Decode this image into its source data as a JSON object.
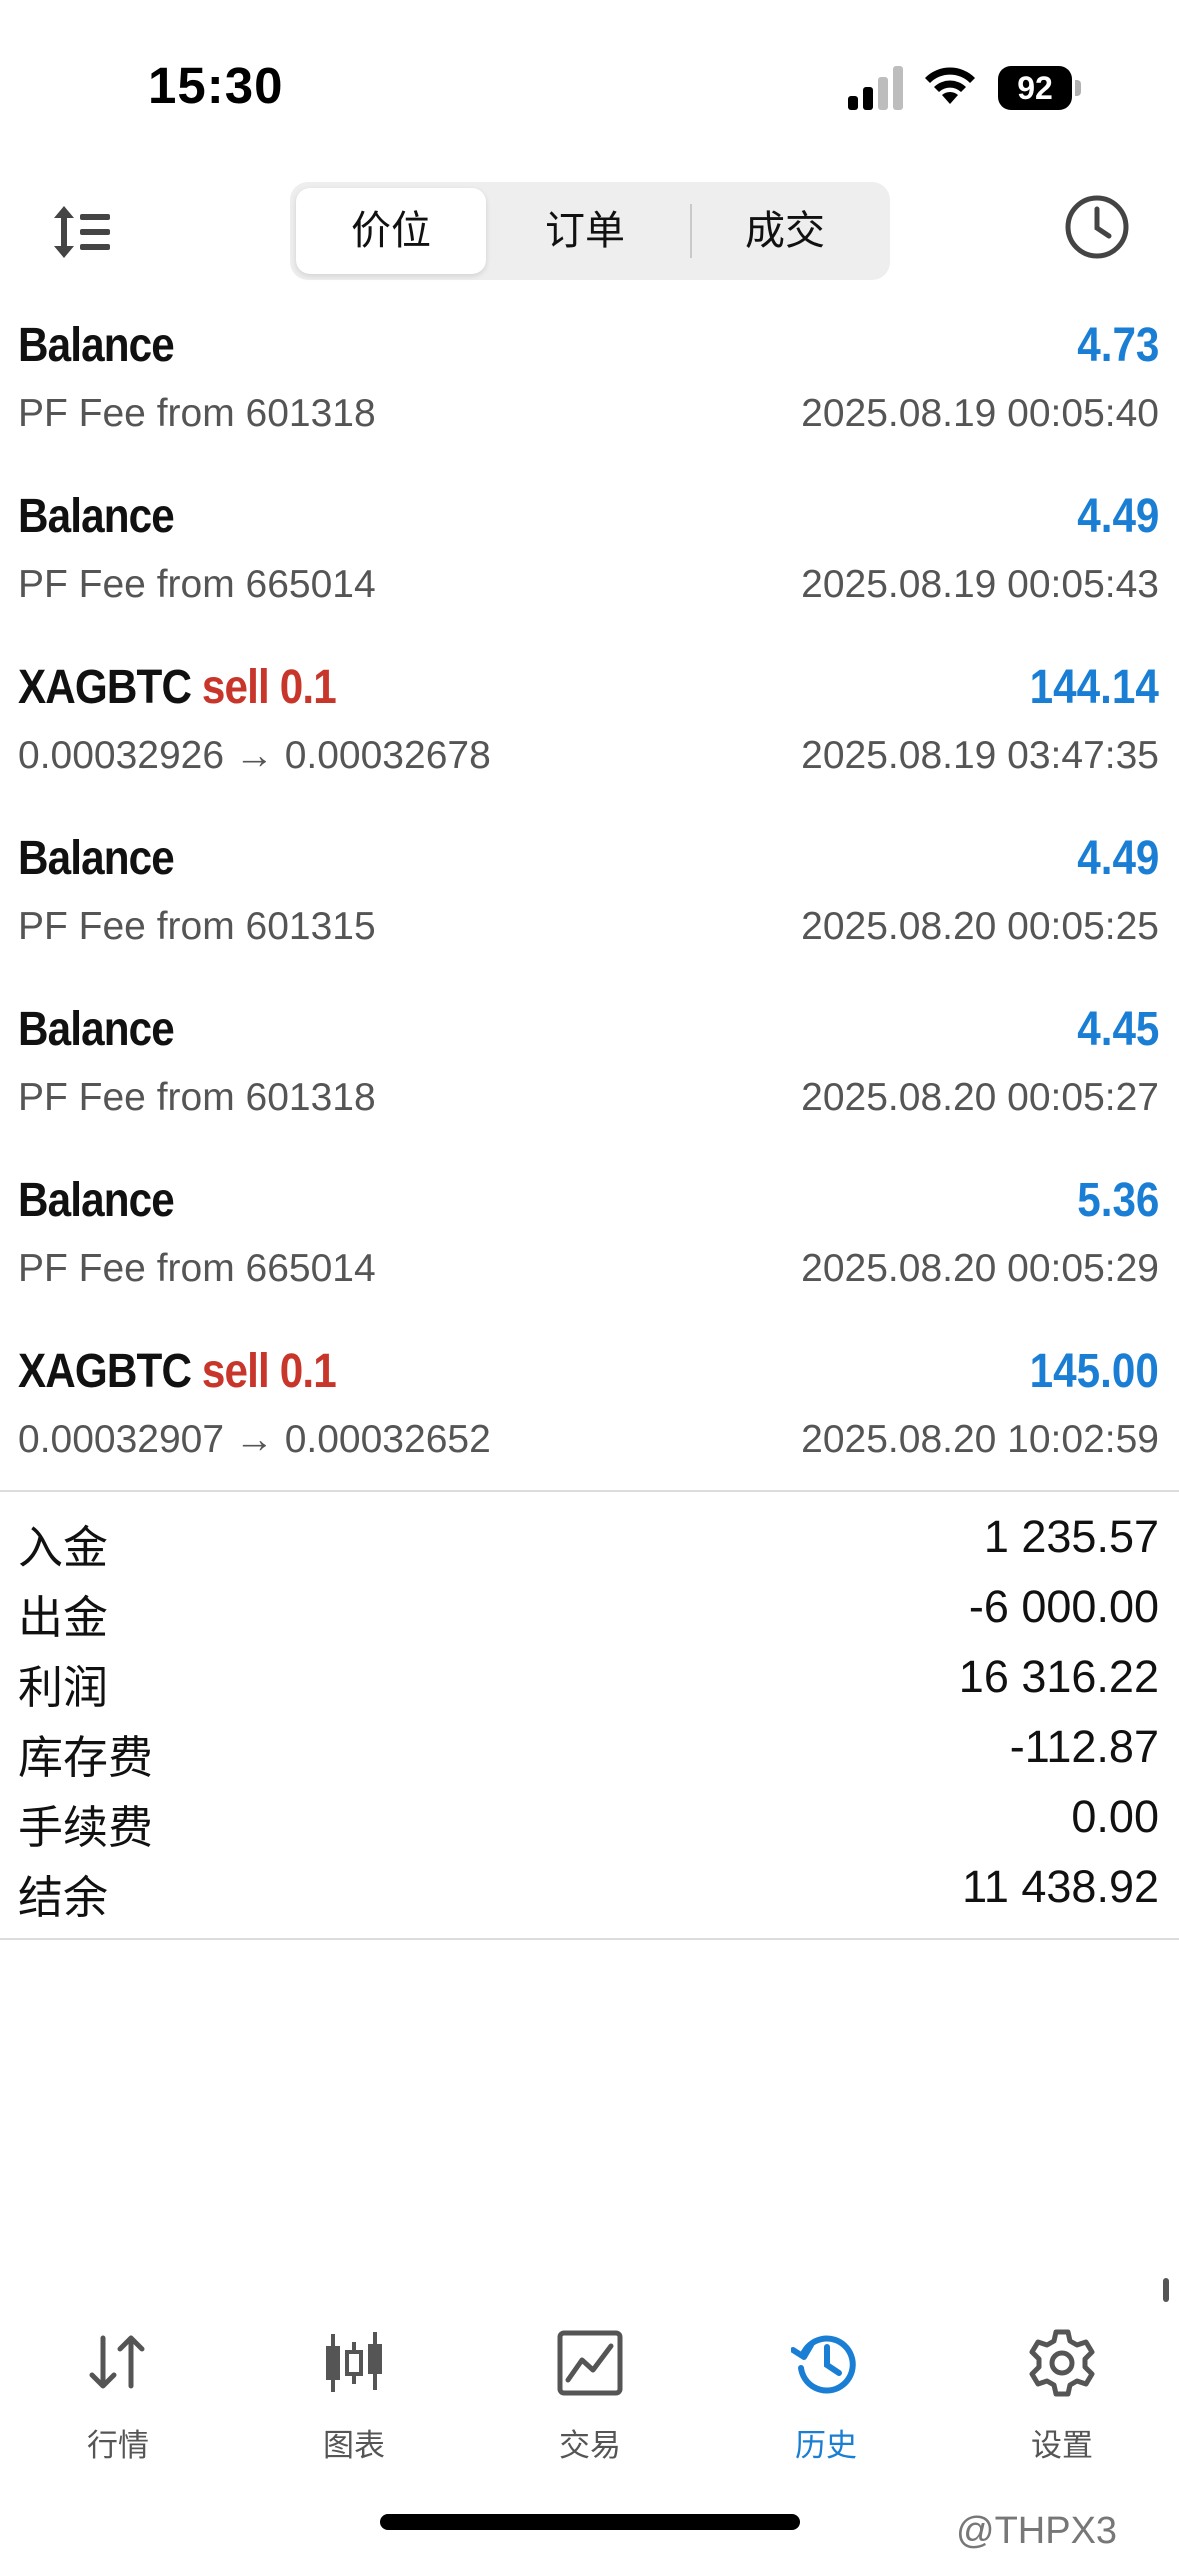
{
  "status": {
    "time": "15:30",
    "battery": "92",
    "icons": [
      "signal-icon",
      "wifi-icon",
      "battery-icon"
    ]
  },
  "header": {
    "tabs": [
      "价位",
      "订单",
      "成交"
    ],
    "selected_tab": "价位",
    "icons": [
      "sort-icon",
      "clock-icon"
    ]
  },
  "deals": [
    {
      "title": "Balance",
      "side": "",
      "profit": "4.73",
      "sub": "PF Fee from 601318",
      "time": "2025.08.19 00:05:40"
    },
    {
      "title": "Balance",
      "side": "",
      "profit": "4.49",
      "sub": "PF Fee from 665014",
      "time": "2025.08.19 00:05:43"
    },
    {
      "title": "XAGBTC",
      "side": "sell 0.1",
      "profit": "144.14",
      "sub": "0.00032926 → 0.00032678",
      "time": "2025.08.19 03:47:35"
    },
    {
      "title": "Balance",
      "side": "",
      "profit": "4.49",
      "sub": "PF Fee from 601315",
      "time": "2025.08.20 00:05:25"
    },
    {
      "title": "Balance",
      "side": "",
      "profit": "4.45",
      "sub": "PF Fee from 601318",
      "time": "2025.08.20 00:05:27"
    },
    {
      "title": "Balance",
      "side": "",
      "profit": "5.36",
      "sub": "PF Fee from 665014",
      "time": "2025.08.20 00:05:29"
    },
    {
      "title": "XAGBTC",
      "side": "sell 0.1",
      "profit": "145.00",
      "sub": "0.00032907 → 0.00032652",
      "time": "2025.08.20 10:02:59"
    }
  ],
  "summary": [
    {
      "label": "入金",
      "value": "1 235.57"
    },
    {
      "label": "出金",
      "value": "-6 000.00"
    },
    {
      "label": "利润",
      "value": "16 316.22"
    },
    {
      "label": "库存费",
      "value": "-112.87"
    },
    {
      "label": "手续费",
      "value": "0.00"
    },
    {
      "label": "结余",
      "value": "11 438.92"
    }
  ],
  "tabbar": [
    {
      "label": "行情",
      "icon": "quotes-icon",
      "active": false
    },
    {
      "label": "图表",
      "icon": "chart-icon",
      "active": false
    },
    {
      "label": "交易",
      "icon": "trade-icon",
      "active": false
    },
    {
      "label": "历史",
      "icon": "history-icon",
      "active": true
    },
    {
      "label": "设置",
      "icon": "gear-icon",
      "active": false
    }
  ],
  "watermark": "@THPX3",
  "colors": {
    "profit": "#1a7fd4",
    "sell": "#c8362b",
    "active_tab": "#1a7fd4"
  }
}
